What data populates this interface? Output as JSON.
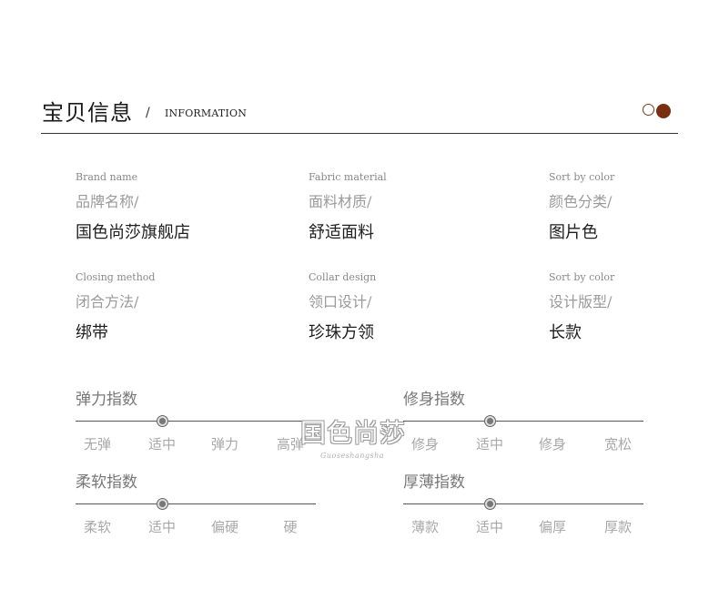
{
  "header": {
    "title": "宝贝信息",
    "slash": "/",
    "subtitle": "INFORMATION"
  },
  "info": [
    {
      "en": "Brand name",
      "zh": "品牌名称/",
      "value": "国色尚莎旗舰店"
    },
    {
      "en": "Fabric material",
      "zh": "面料材质/",
      "value": "舒适面料"
    },
    {
      "en": "Sort by color",
      "zh": "颜色分类/",
      "value": "图片色"
    },
    {
      "en": "Closing method",
      "zh": "闭合方法/",
      "value": "绑带"
    },
    {
      "en": "Collar design",
      "zh": "领口设计/",
      "value": "珍珠方领"
    },
    {
      "en": "Sort by color",
      "zh": "设计版型/",
      "value": "长款"
    }
  ],
  "indices": [
    {
      "title": "弹力指数",
      "options": [
        "无弹",
        "适中",
        "弹力",
        "高弹"
      ],
      "selected_index": 1
    },
    {
      "title": "修身指数",
      "options": [
        "修身",
        "适中",
        "修身",
        "宽松"
      ],
      "selected_index": 1
    },
    {
      "title": "柔软指数",
      "options": [
        "柔软",
        "适中",
        "偏硬",
        "硬"
      ],
      "selected_index": 1
    },
    {
      "title": "厚薄指数",
      "options": [
        "薄款",
        "适中",
        "偏厚",
        "厚款"
      ],
      "selected_index": 1
    }
  ],
  "watermark": {
    "text": "国色尚莎",
    "sub": "Guoseshangsha"
  },
  "colors": {
    "accent": "#7a2e10",
    "text": "#1e1e1e",
    "muted": "#9a9a9a"
  }
}
